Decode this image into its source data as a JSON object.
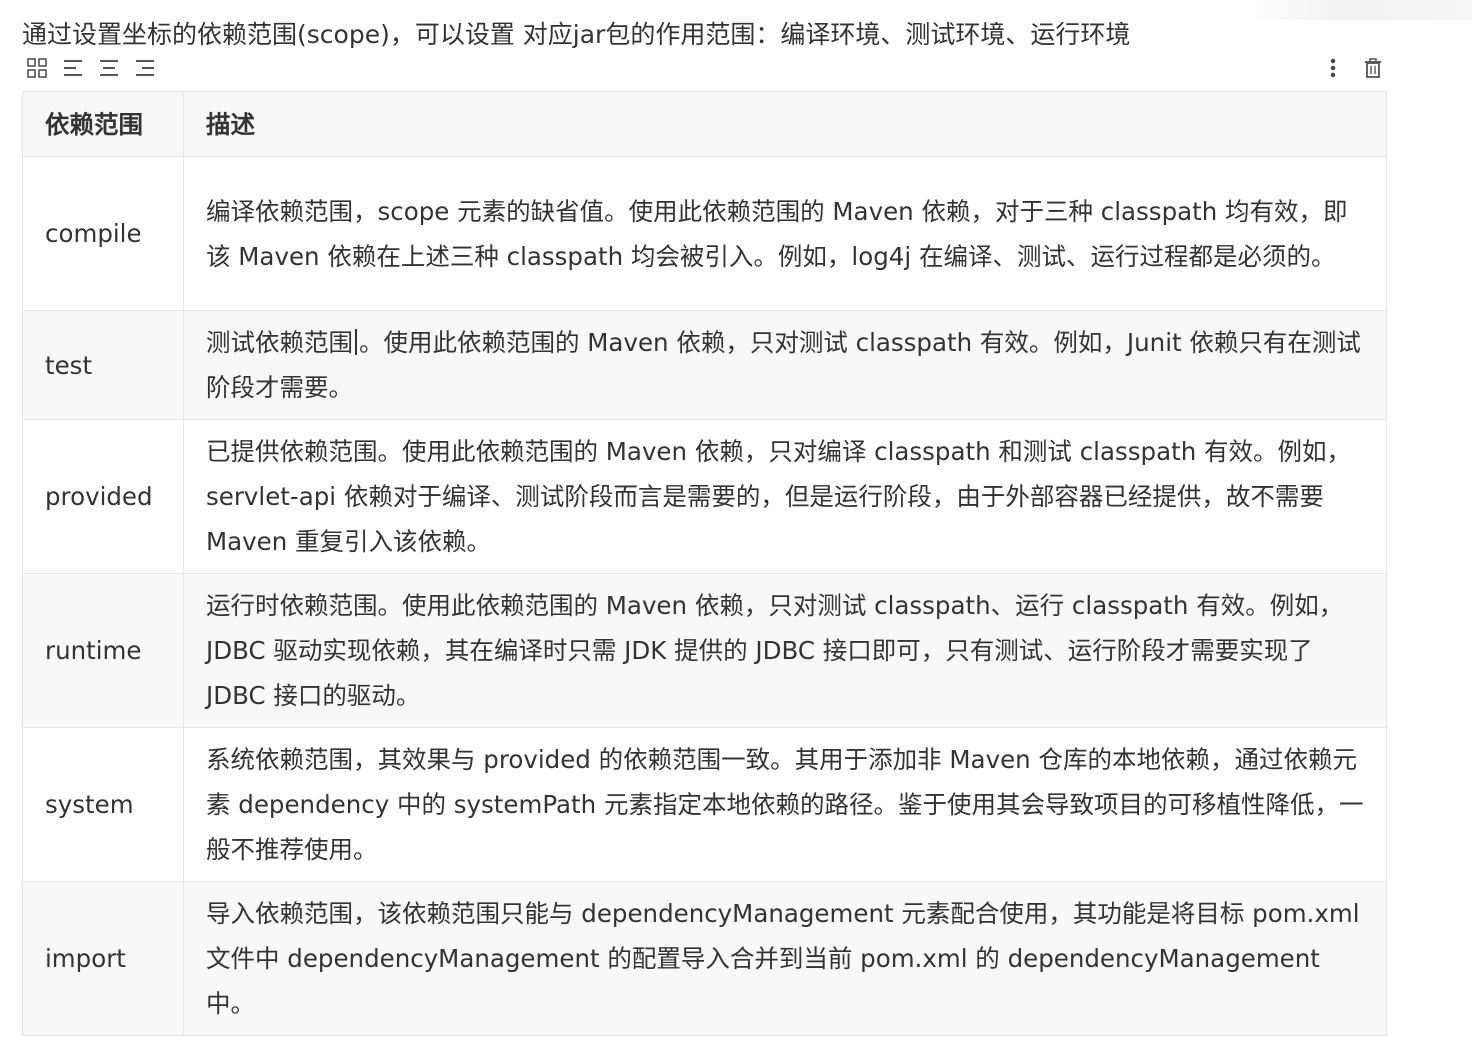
{
  "intro": "通过设置坐标的依赖范围(scope)，可以设置 对应jar包的作用范围：编译环境、测试环境、运行环境",
  "toolbar": {
    "left_icons": [
      "table-grid-icon",
      "align-left-icon",
      "align-center-icon",
      "align-right-icon"
    ],
    "right_icons": [
      "more-vertical-icon",
      "trash-icon"
    ]
  },
  "table": {
    "headers": [
      "依赖范围",
      "描述"
    ],
    "rows": [
      {
        "scope": "compile",
        "desc": "编译依赖范围，scope 元素的缺省值。使用此依赖范围的 Maven 依赖，对于三种 classpath 均有效，即该 Maven 依赖在上述三种 classpath 均会被引入。例如，log4j 在编译、测试、运行过程都是必须的。"
      },
      {
        "scope": "test",
        "desc_before_cursor": "测试依赖范围",
        "desc_after_cursor": "。使用此依赖范围的 Maven 依赖，只对测试 classpath 有效。例如，Junit 依赖只有在测试阶段才需要。"
      },
      {
        "scope": "provided",
        "desc": "已提供依赖范围。使用此依赖范围的 Maven 依赖，只对编译 classpath 和测试 classpath 有效。例如，servlet-api 依赖对于编译、测试阶段而言是需要的，但是运行阶段，由于外部容器已经提供，故不需要 Maven 重复引入该依赖。"
      },
      {
        "scope": "runtime",
        "desc": "运行时依赖范围。使用此依赖范围的 Maven 依赖，只对测试 classpath、运行 classpath 有效。例如，JDBC 驱动实现依赖，其在编译时只需 JDK 提供的 JDBC 接口即可，只有测试、运行阶段才需要实现了 JDBC 接口的驱动。"
      },
      {
        "scope": "system",
        "desc": "系统依赖范围，其效果与 provided 的依赖范围一致。其用于添加非 Maven 仓库的本地依赖，通过依赖元素 dependency 中的 systemPath 元素指定本地依赖的路径。鉴于使用其会导致项目的可移植性降低，一般不推荐使用。"
      },
      {
        "scope": "import",
        "desc": "导入依赖范围，该依赖范围只能与 dependencyManagement 元素配合使用，其功能是将目标 pom.xml 文件中 dependencyManagement 的配置导入合并到当前 pom.xml 的 dependencyManagement 中。"
      }
    ]
  }
}
